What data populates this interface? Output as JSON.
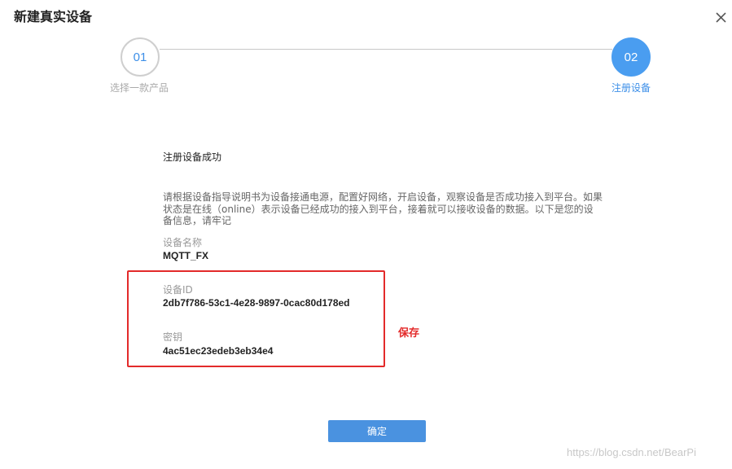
{
  "dialog": {
    "title": "新建真实设备",
    "close_icon": "close-icon"
  },
  "steps": [
    {
      "number": "01",
      "label": "选择一款产品",
      "state": "inactive"
    },
    {
      "number": "02",
      "label": "注册设备",
      "state": "active"
    }
  ],
  "content": {
    "success_text": "注册设备成功",
    "description": "请根据设备指导说明书为设备接通电源，配置好网络，开启设备，观察设备是否成功接入到平台。如果状态是在线（online）表示设备已经成功的接入到平台，接着就可以接收设备的数据。以下是您的设备信息，请牢记",
    "device_name_label": "设备名称",
    "device_name_value": "MQTT_FX",
    "device_id_label": "设备ID",
    "device_id_value": "2db7f786-53c1-4e28-9897-0cac80d178ed",
    "secret_label": "密钥",
    "secret_value": "4ac51ec23edeb3eb34e4"
  },
  "annotation": {
    "save_note": "保存",
    "color": "#e32a2a"
  },
  "footer": {
    "confirm_label": "确定"
  },
  "watermark": "https://blog.csdn.net/BearPi",
  "colors": {
    "accent": "#4a9df0",
    "button": "#4a92e0"
  }
}
